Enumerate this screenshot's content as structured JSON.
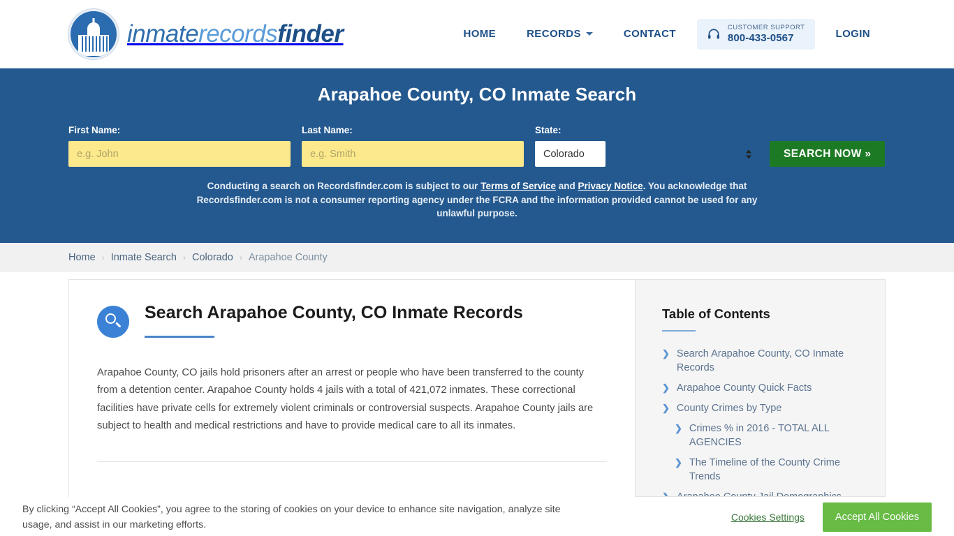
{
  "brand": {
    "part1": "inmate",
    "part2": "records",
    "part3": "finder",
    "seal_icon": "capitol-dome-icon"
  },
  "nav": {
    "home": "HOME",
    "records": "RECORDS",
    "contact": "CONTACT",
    "login": "LOGIN",
    "support_label": "CUSTOMER SUPPORT",
    "support_phone": "800-433-0567",
    "support_icon": "headset-icon",
    "chevron_icon": "chevron-down-icon"
  },
  "hero": {
    "title": "Arapahoe County, CO Inmate Search",
    "first_name_label": "First Name:",
    "first_name_placeholder": "e.g. John",
    "first_name_value": "",
    "last_name_label": "Last Name:",
    "last_name_placeholder": "e.g. Smith",
    "last_name_value": "",
    "state_label": "State:",
    "state_value": "Colorado",
    "state_options": [
      "Colorado"
    ],
    "search_button": "SEARCH NOW »",
    "disclaimer_part1": "Conducting a search on Recordsfinder.com is subject to our ",
    "disclaimer_link1": "Terms of Service",
    "disclaimer_part2": " and ",
    "disclaimer_link2": "Privacy Notice",
    "disclaimer_part3": ". You acknowledge that Recordsfinder.com is not a consumer reporting agency under the FCRA and the information provided cannot be used for any unlawful purpose."
  },
  "breadcrumb": {
    "items": [
      {
        "label": "Home"
      },
      {
        "label": "Inmate Search"
      },
      {
        "label": "Colorado"
      },
      {
        "label": "Arapahoe County"
      }
    ],
    "separator": "›"
  },
  "main": {
    "icon": "search-circle-icon",
    "heading": "Search Arapahoe County, CO Inmate Records",
    "paragraph": "Arapahoe County, CO jails hold prisoners after an arrest or people who have been transferred to the county from a detention center. Arapahoe County holds 4 jails with a total of 421,072 inmates. These correctional facilities have private cells for extremely violent criminals or controversial suspects. Arapahoe County jails are subject to health and medical restrictions and have to provide medical care to all its inmates."
  },
  "toc": {
    "title": "Table of Contents",
    "chevron": "❯",
    "items": [
      {
        "label": "Search Arapahoe County, CO Inmate Records",
        "sub": false
      },
      {
        "label": "Arapahoe County Quick Facts",
        "sub": false
      },
      {
        "label": "County Crimes by Type",
        "sub": false
      },
      {
        "label": "Crimes % in 2016 - TOTAL ALL AGENCIES",
        "sub": true
      },
      {
        "label": "The Timeline of the County Crime Trends",
        "sub": true
      },
      {
        "label": "Arapahoe County Jail Demographics",
        "sub": false
      }
    ]
  },
  "cookies": {
    "text": "By clicking “Accept All Cookies”, you agree to the storing of cookies on your device to enhance site navigation, analyze site usage, and assist in our marketing efforts.",
    "settings_label": "Cookies Settings",
    "accept_label": "Accept All Cookies"
  },
  "colors": {
    "hero_blue": "#24598f",
    "brand_blue": "#1d4f87",
    "accent_blue": "#3b82d6",
    "search_green": "#1d7a24",
    "cookie_green": "#68bb45",
    "input_yellow": "#fbe98c"
  }
}
